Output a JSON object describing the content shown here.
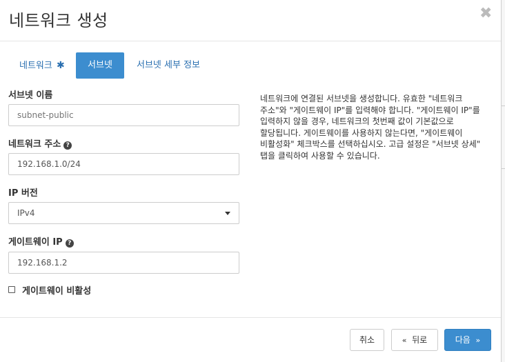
{
  "modal": {
    "title": "네트워크 생성",
    "close_glyph": "✖"
  },
  "tabs": [
    {
      "label": "네트워크",
      "required_mark": "✱",
      "active": false
    },
    {
      "label": "서브넷",
      "active": true
    },
    {
      "label": "서브넷 세부 정보",
      "active": false
    }
  ],
  "form": {
    "subnet_name": {
      "label": "서브넷 이름",
      "placeholder": "subnet-public"
    },
    "network_address": {
      "label": "네트워크 주소",
      "value": "192.168.1.0/24"
    },
    "ip_version": {
      "label": "IP 버전",
      "selected": "IPv4"
    },
    "gateway_ip": {
      "label": "게이트웨이 IP",
      "value": "192.168.1.2"
    },
    "disable_gateway": {
      "label": "게이트웨이 비활성",
      "checked": false
    }
  },
  "help": {
    "text": "네트워크에 연결된 서브넷을 생성합니다. 유효한 \"네트워크 주소\"와 \"게이트웨이 IP\"를 입력해야 합니다. \"게이트웨이 IP\"를 입력하지 않을 경우, 네트워크의 첫번째 값이 기본값으로 할당됩니다. 게이트웨이를 사용하지 않는다면, \"게이트웨이 비활성화\" 체크박스를 선택하십시오. 고급 설정은 \"서브넷 상세\" 탭을 클릭하여 사용할 수 있습니다."
  },
  "footer": {
    "cancel_label": "취소",
    "back_label": "뒤로",
    "back_glyph": "«",
    "next_label": "다음",
    "next_glyph": "»"
  },
  "colors": {
    "accent": "#3c8dcf",
    "link": "#2a6fb0"
  }
}
